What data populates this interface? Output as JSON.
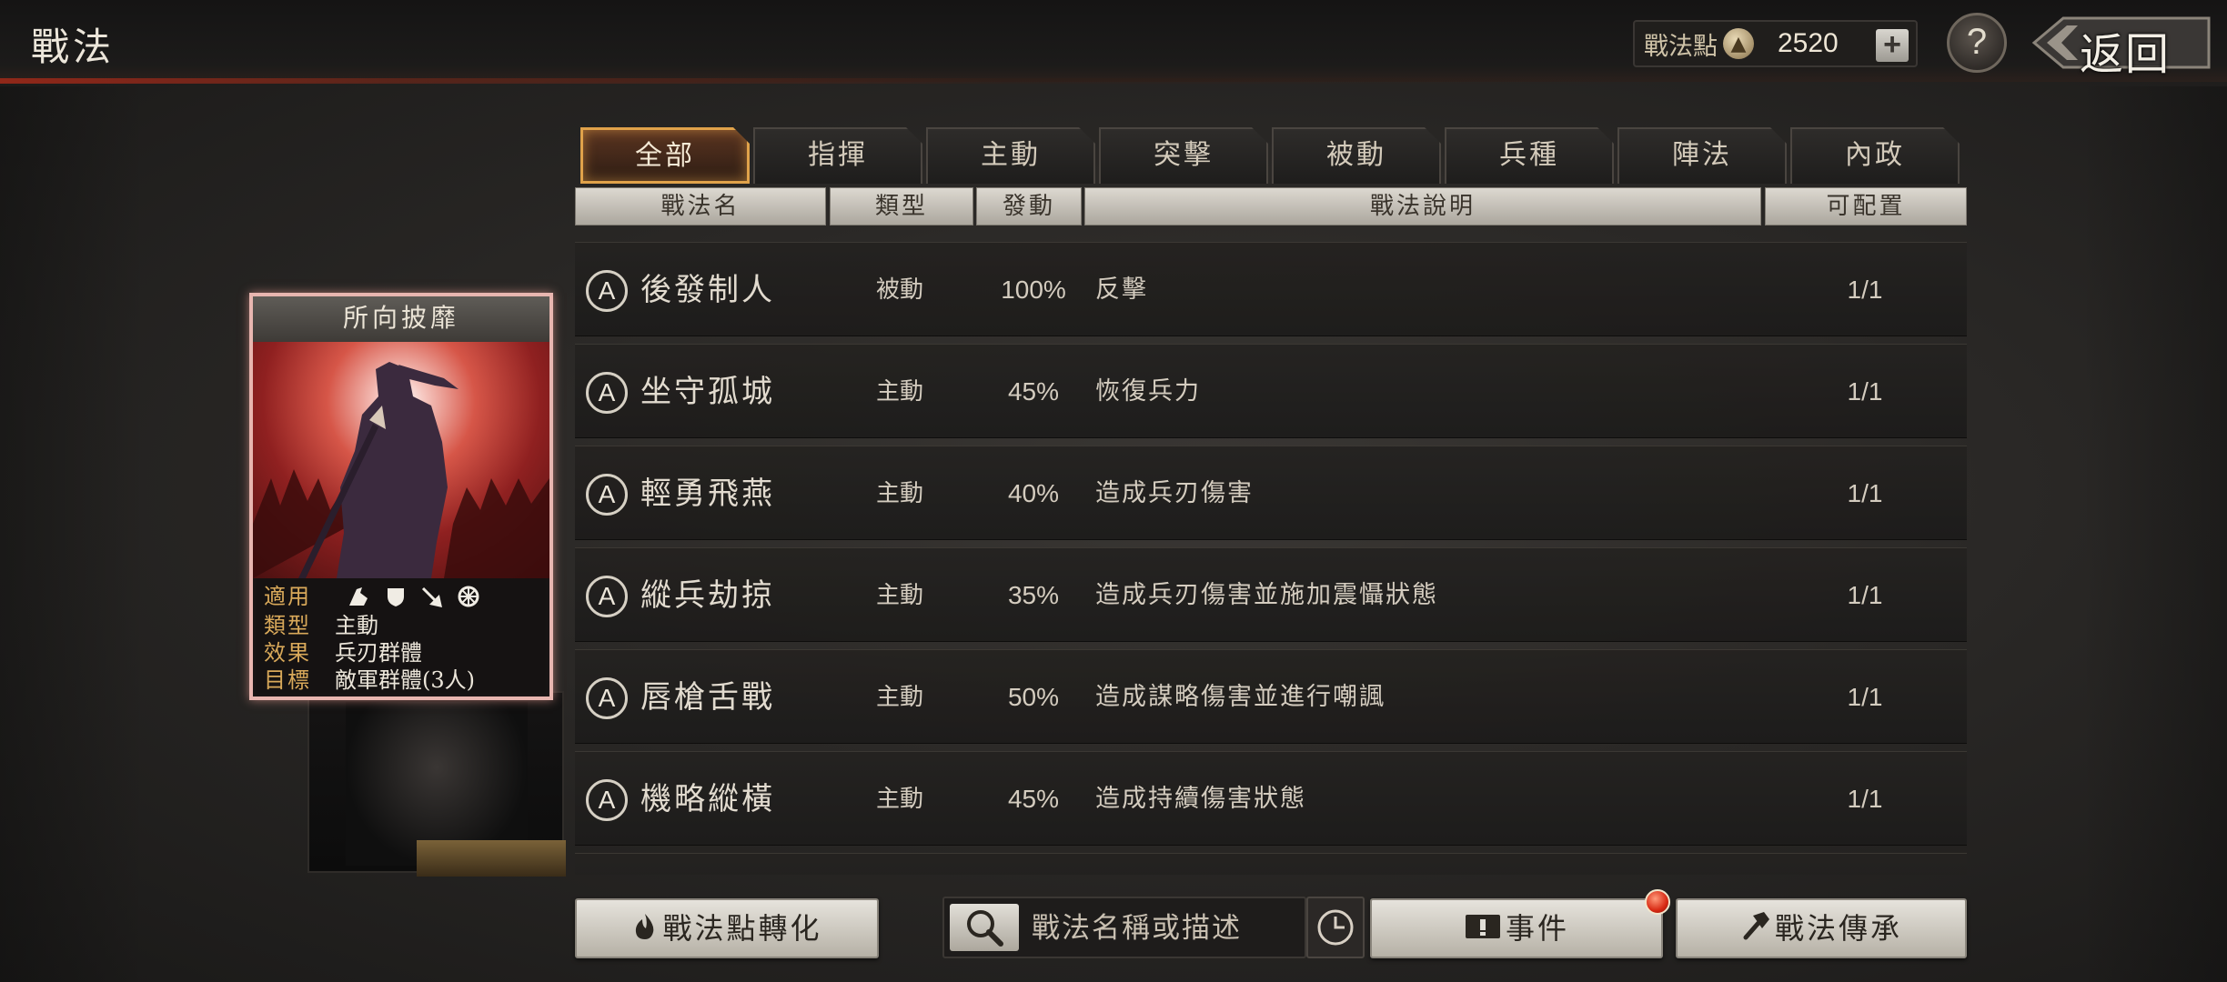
{
  "header": {
    "title": "戰法",
    "points_label": "戰法點",
    "points_value": "2520",
    "back_label": "返回"
  },
  "tabs": [
    {
      "label": "全部",
      "active": true
    },
    {
      "label": "指揮",
      "active": false
    },
    {
      "label": "主動",
      "active": false
    },
    {
      "label": "突擊",
      "active": false
    },
    {
      "label": "被動",
      "active": false
    },
    {
      "label": "兵種",
      "active": false
    },
    {
      "label": "陣法",
      "active": false
    },
    {
      "label": "內政",
      "active": false
    }
  ],
  "columns": {
    "name": "戰法名",
    "type": "類型",
    "rate": "發動",
    "desc": "戰法說明",
    "config": "可配置"
  },
  "tactics": [
    {
      "grade": "A",
      "name": "後發制人",
      "type": "被動",
      "rate": "100%",
      "desc": "反擊",
      "config": "1/1"
    },
    {
      "grade": "A",
      "name": "坐守孤城",
      "type": "主動",
      "rate": "45%",
      "desc": "恢復兵力",
      "config": "1/1"
    },
    {
      "grade": "A",
      "name": "輕勇飛燕",
      "type": "主動",
      "rate": "40%",
      "desc": "造成兵刃傷害",
      "config": "1/1"
    },
    {
      "grade": "A",
      "name": "縱兵劫掠",
      "type": "主動",
      "rate": "35%",
      "desc": "造成兵刃傷害並施加震懾狀態",
      "config": "1/1"
    },
    {
      "grade": "A",
      "name": "唇槍舌戰",
      "type": "主動",
      "rate": "50%",
      "desc": "造成謀略傷害並進行嘲諷",
      "config": "1/1"
    },
    {
      "grade": "A",
      "name": "機略縱橫",
      "type": "主動",
      "rate": "45%",
      "desc": "造成持續傷害狀態",
      "config": "1/1"
    }
  ],
  "card": {
    "title": "所向披靡",
    "applies_label": "適用",
    "type_label": "類型",
    "type_value": "主動",
    "effect_label": "效果",
    "effect_value": "兵刃群體",
    "target_label": "目標",
    "target_value": "敵軍群體(3人)",
    "unit_icons": [
      "cavalry-icon",
      "shield-icon",
      "bow-icon",
      "chariot-wheel-icon"
    ]
  },
  "footer": {
    "convert_label": "戰法點轉化",
    "search_placeholder": "戰法名稱或描述",
    "event_label": "事件",
    "inherit_label": "戰法傳承"
  },
  "colors": {
    "active_tab_border": "#e0a24a",
    "card_border": "#e8b6b0",
    "notif_red": "#d82a14"
  }
}
